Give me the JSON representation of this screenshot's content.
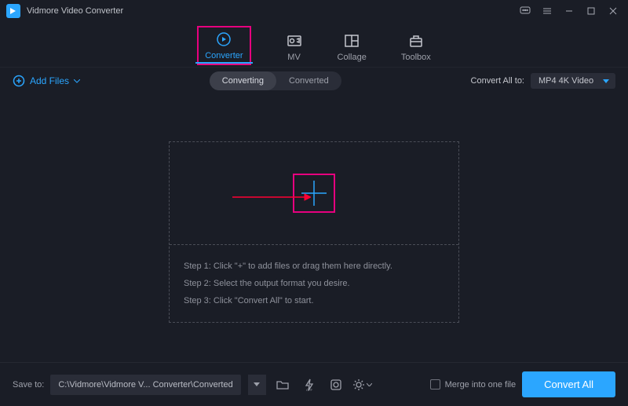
{
  "title": "Vidmore Video Converter",
  "tabs": {
    "converter": "Converter",
    "mv": "MV",
    "collage": "Collage",
    "toolbox": "Toolbox"
  },
  "subbar": {
    "add_files": "Add Files",
    "converting": "Converting",
    "converted": "Converted",
    "convert_all_to": "Convert All to:",
    "format": "MP4 4K Video"
  },
  "drop": {
    "step1": "Step 1: Click \"+\" to add files or drag them here directly.",
    "step2": "Step 2: Select the output format you desire.",
    "step3": "Step 3: Click \"Convert All\" to start."
  },
  "footer": {
    "save_to": "Save to:",
    "path": "C:\\Vidmore\\Vidmore V... Converter\\Converted",
    "merge": "Merge into one file",
    "convert_all": "Convert All"
  }
}
